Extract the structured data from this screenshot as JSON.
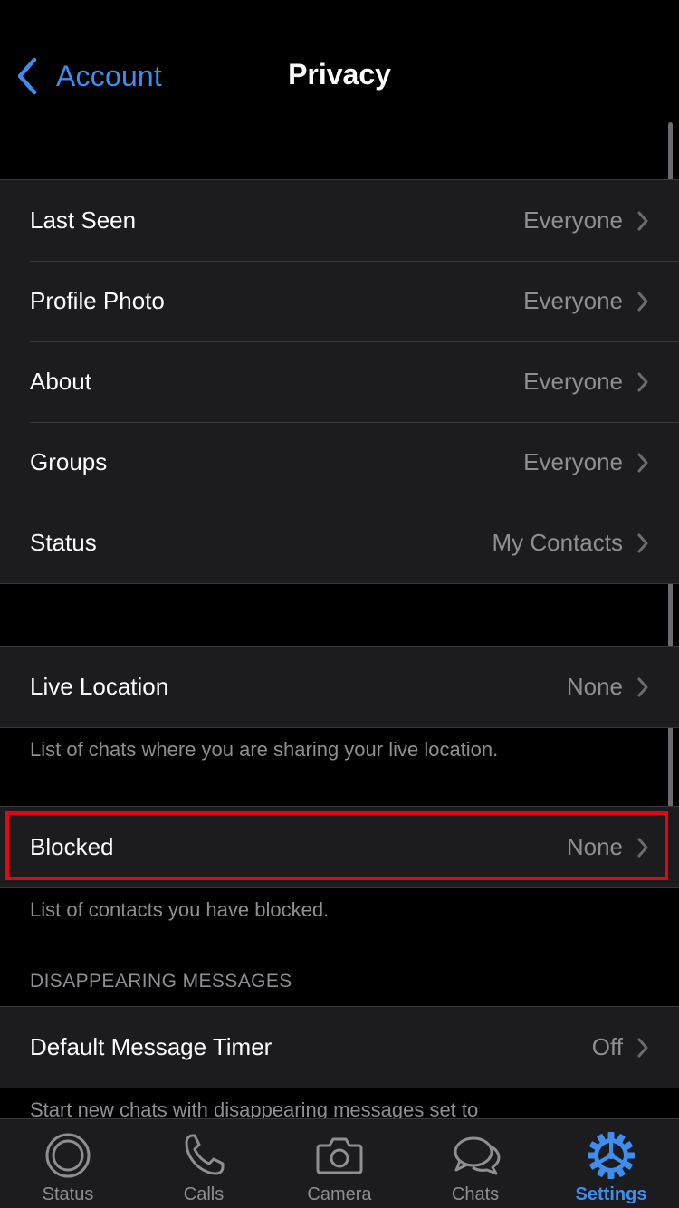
{
  "nav": {
    "back_label": "Account",
    "title": "Privacy"
  },
  "privacy_group": [
    {
      "label": "Last Seen",
      "value": "Everyone"
    },
    {
      "label": "Profile Photo",
      "value": "Everyone"
    },
    {
      "label": "About",
      "value": "Everyone"
    },
    {
      "label": "Groups",
      "value": "Everyone"
    },
    {
      "label": "Status",
      "value": "My Contacts"
    }
  ],
  "live_location": {
    "label": "Live Location",
    "value": "None",
    "footer": "List of chats where you are sharing your live location."
  },
  "blocked": {
    "label": "Blocked",
    "value": "None",
    "footer": "List of contacts you have blocked."
  },
  "disappearing": {
    "header": "DISAPPEARING MESSAGES",
    "label": "Default Message Timer",
    "value": "Off",
    "footer": "Start new chats with disappearing messages set to"
  },
  "tabs": [
    {
      "label": "Status",
      "icon": "status-icon"
    },
    {
      "label": "Calls",
      "icon": "phone-icon"
    },
    {
      "label": "Camera",
      "icon": "camera-icon"
    },
    {
      "label": "Chats",
      "icon": "chats-icon"
    },
    {
      "label": "Settings",
      "icon": "settings-gear-icon",
      "active": true
    }
  ],
  "colors": {
    "accent": "#3d8ef0",
    "highlight": "#e3050f",
    "cell_bg": "#1c1c1e",
    "secondary_text": "#8e8e93"
  }
}
